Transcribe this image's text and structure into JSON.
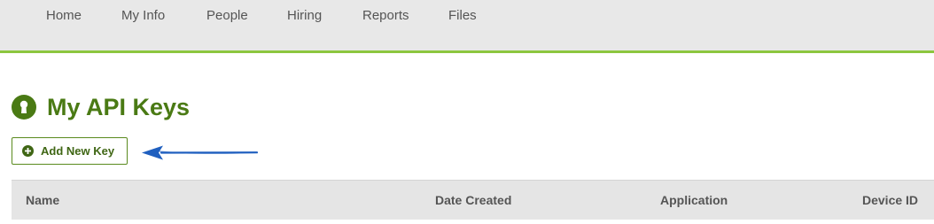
{
  "nav": {
    "items": [
      {
        "label": "Home"
      },
      {
        "label": "My Info"
      },
      {
        "label": "People"
      },
      {
        "label": "Hiring"
      },
      {
        "label": "Reports"
      },
      {
        "label": "Files"
      }
    ]
  },
  "page": {
    "title": "My API Keys",
    "title_icon": "keyhole-icon"
  },
  "actions": {
    "add_key_label": "Add New Key",
    "add_key_icon": "plus-circle-icon"
  },
  "table": {
    "columns": [
      "Name",
      "Date Created",
      "Application",
      "Device ID"
    ]
  },
  "colors": {
    "accent": "#8cc63f",
    "title": "#4a7a14",
    "button_border": "#5a8a1e",
    "annotation_arrow": "#1f5fbf"
  }
}
